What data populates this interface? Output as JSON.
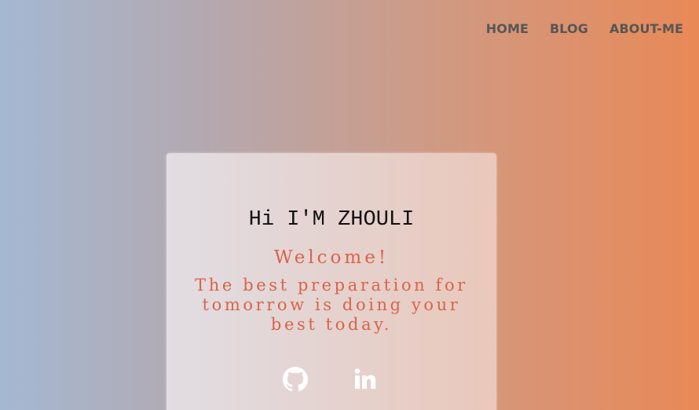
{
  "nav": {
    "items": [
      {
        "label": "HOME"
      },
      {
        "label": "BLOG"
      },
      {
        "label": "ABOUT-ME"
      }
    ]
  },
  "card": {
    "title": "Hi I'M ZHOULI",
    "welcome": "Welcome!",
    "quote": "The best preparation for tomorrow is doing your best today."
  },
  "social": {
    "icons": [
      "github-icon",
      "linkedin-icon"
    ]
  },
  "colors": {
    "gradient_left": "#a4b8d2",
    "gradient_right": "#e98957",
    "nav_text": "#565656",
    "accent_text": "#d9644a"
  }
}
